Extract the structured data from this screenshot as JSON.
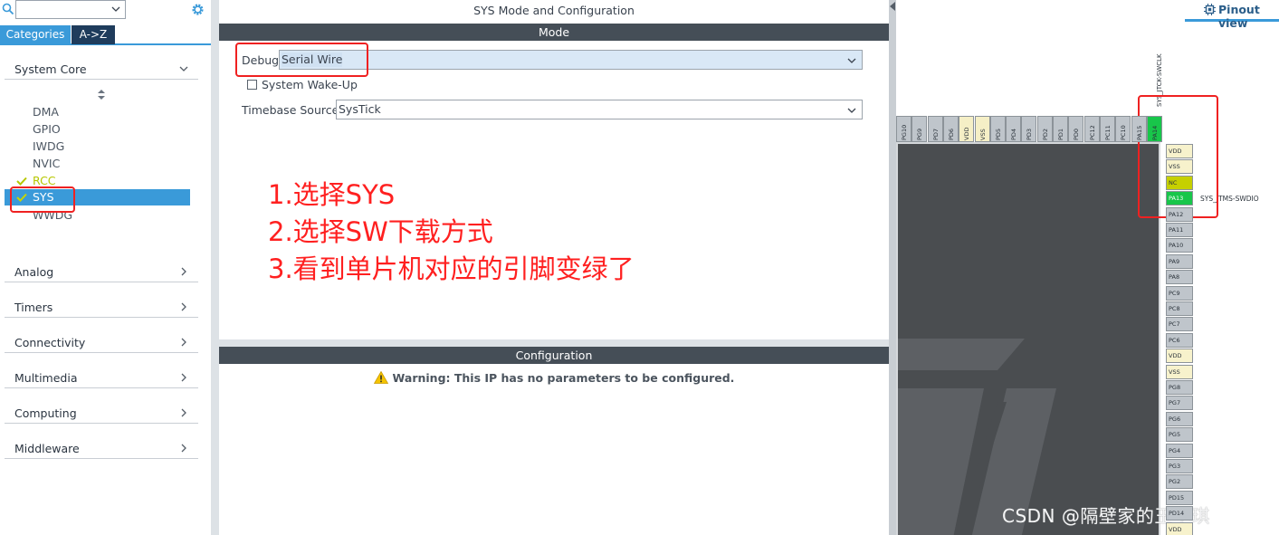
{
  "left_panel": {
    "search": {
      "value": ""
    },
    "tabs": [
      {
        "label": "Categories",
        "active": true
      },
      {
        "label": "A->Z",
        "active": false
      }
    ],
    "categories": {
      "system_core": {
        "label": "System Core",
        "items": [
          {
            "label": "DMA",
            "state": "normal"
          },
          {
            "label": "GPIO",
            "state": "normal"
          },
          {
            "label": "IWDG",
            "state": "normal"
          },
          {
            "label": "NVIC",
            "state": "normal"
          },
          {
            "label": "RCC",
            "state": "checked"
          },
          {
            "label": "SYS",
            "state": "selected"
          },
          {
            "label": "WWDG",
            "state": "normal"
          }
        ]
      },
      "collapsed": [
        {
          "label": "Analog"
        },
        {
          "label": "Timers"
        },
        {
          "label": "Connectivity"
        },
        {
          "label": "Multimedia"
        },
        {
          "label": "Computing"
        },
        {
          "label": "Middleware"
        }
      ]
    }
  },
  "main_panel": {
    "title": "SYS Mode and Configuration",
    "mode_section": "Mode",
    "debug": {
      "label": "Debug",
      "value": "Serial Wire"
    },
    "system_wakeup": {
      "label": "System Wake-Up",
      "checked": false
    },
    "timebase": {
      "label": "Timebase Source",
      "value": "SysTick"
    },
    "config_section": "Configuration",
    "warning": "Warning: This IP has no parameters to be configured."
  },
  "annotation": {
    "lines": [
      "1.选择SYS",
      "2.选择SW下载方式",
      "3.看到单片机对应的引脚变绿了"
    ],
    "color": "#ff2020"
  },
  "pinout": {
    "tab_label": "Pinout view",
    "top_pins": [
      {
        "label": "PG10",
        "color": "gray"
      },
      {
        "label": "PG9",
        "color": "gray"
      },
      {
        "label": "PD7",
        "color": "gray"
      },
      {
        "label": "PD6",
        "color": "gray"
      },
      {
        "label": "VDD",
        "color": "yellow"
      },
      {
        "label": "VSS",
        "color": "yellow"
      },
      {
        "label": "PD5",
        "color": "gray"
      },
      {
        "label": "PD4",
        "color": "gray"
      },
      {
        "label": "PD3",
        "color": "gray"
      },
      {
        "label": "PD2",
        "color": "gray"
      },
      {
        "label": "PD1",
        "color": "gray"
      },
      {
        "label": "PD0",
        "color": "gray"
      },
      {
        "label": "PC12",
        "color": "gray"
      },
      {
        "label": "PC11",
        "color": "gray"
      },
      {
        "label": "PC10",
        "color": "gray"
      },
      {
        "label": "PA15",
        "color": "gray"
      },
      {
        "label": "PA14",
        "color": "green"
      }
    ],
    "right_pins": [
      {
        "label": "VDD",
        "color": "yellow"
      },
      {
        "label": "VSS",
        "color": "yellow"
      },
      {
        "label": "NC",
        "color": "lime"
      },
      {
        "label": "PA13",
        "color": "green"
      },
      {
        "label": "PA12",
        "color": "gray"
      },
      {
        "label": "PA11",
        "color": "gray"
      },
      {
        "label": "PA10",
        "color": "gray"
      },
      {
        "label": "PA9",
        "color": "gray"
      },
      {
        "label": "PA8",
        "color": "gray"
      },
      {
        "label": "PC9",
        "color": "gray"
      },
      {
        "label": "PC8",
        "color": "gray"
      },
      {
        "label": "PC7",
        "color": "gray"
      },
      {
        "label": "PC6",
        "color": "gray"
      },
      {
        "label": "VDD",
        "color": "yellow"
      },
      {
        "label": "VSS",
        "color": "yellow"
      },
      {
        "label": "PG8",
        "color": "gray"
      },
      {
        "label": "PG7",
        "color": "gray"
      },
      {
        "label": "PG6",
        "color": "gray"
      },
      {
        "label": "PG5",
        "color": "gray"
      },
      {
        "label": "PG4",
        "color": "gray"
      },
      {
        "label": "PG3",
        "color": "gray"
      },
      {
        "label": "PG2",
        "color": "gray"
      },
      {
        "label": "PD15",
        "color": "gray"
      },
      {
        "label": "PD14",
        "color": "gray"
      },
      {
        "label": "VDD",
        "color": "yellow"
      }
    ],
    "signal_swclk": "SYS_JTCK-SWCLK",
    "signal_swdio": "SYS_JTMS-SWDIO"
  },
  "watermark": "CSDN @隔壁家的王小琪",
  "colors": {
    "accent": "#3a9ad9",
    "dark_tab": "#1f3c5c",
    "section_bar": "#454e57",
    "pin_green": "#18c64a",
    "highlight_red": "#ef2121"
  }
}
